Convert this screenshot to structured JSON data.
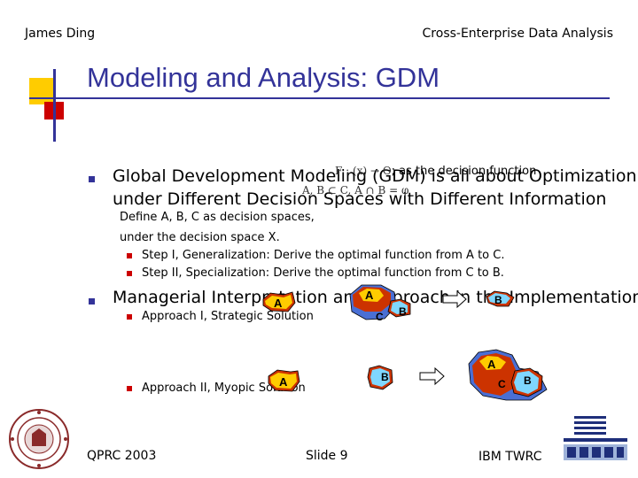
{
  "header": {
    "author": "James Ding",
    "course": "Cross-Enterprise Data Analysis"
  },
  "title": "Modeling and Analysis: GDM",
  "bullet1": {
    "line1": "Global Development Modeling (GDM) is all about Optimization",
    "line2": "under Different Decision Spaces with Different Information",
    "formula_top": "F : (x) → O",
    "formula_top_suffix": "; as the decision function",
    "formula_bottom": "A, B ⊂ C, A ∩ B = φ",
    "define1": "Define A, B, C as decision spaces,",
    "define2": "under the decision space X.",
    "step1": "Step I, Generalization: Derive the optimal function from A to C.",
    "step2": "Step II, Specialization: Derive the optimal function from C to B."
  },
  "bullet2": {
    "text": "Managerial Interpretation and Approach in the Implementation",
    "approach1": "Approach I, Strategic Solution",
    "approach2": "Approach II, Myopic Solution"
  },
  "diagram": {
    "label_a": "A",
    "label_b": "B",
    "label_c": "C"
  },
  "footer": {
    "left": "QPRC 2003",
    "center": "Slide 9",
    "right": "IBM TWRC"
  },
  "colors": {
    "title": "#333399",
    "accent_yellow": "#ffcc00",
    "accent_red": "#cc0000",
    "blob_red": "#cc3300",
    "blob_blue": "#4a6fd4",
    "blob_cyan": "#7fd7ff"
  }
}
